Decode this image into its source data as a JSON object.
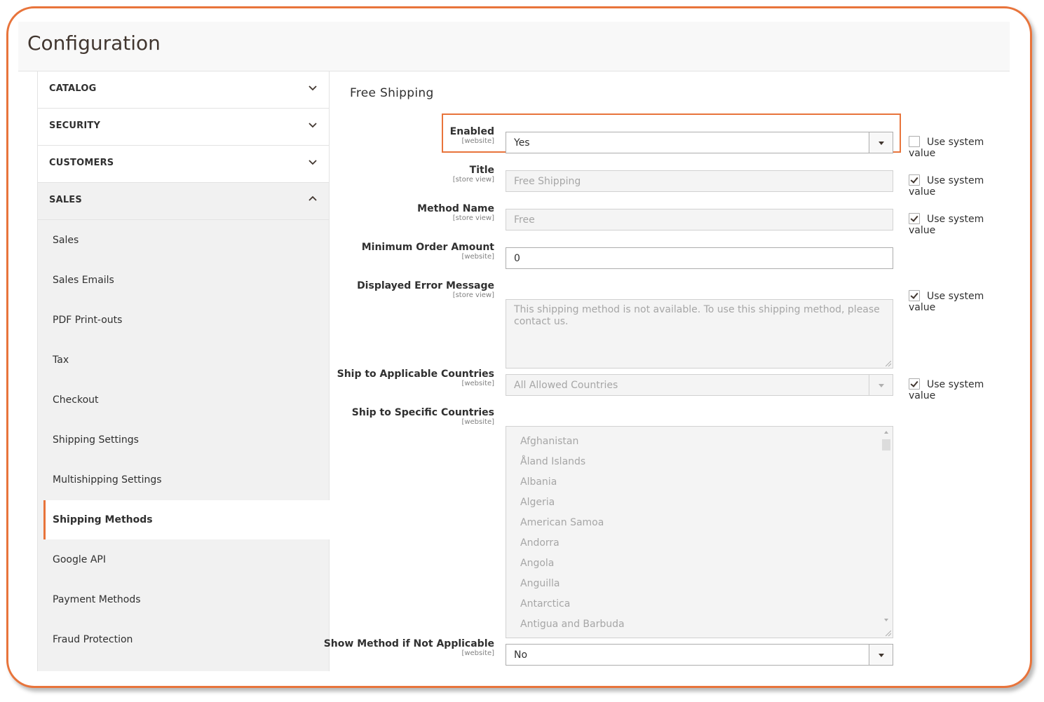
{
  "header": {
    "title": "Configuration"
  },
  "sidebar": {
    "sections": [
      {
        "label": "CATALOG",
        "expanded": false
      },
      {
        "label": "SECURITY",
        "expanded": false
      },
      {
        "label": "CUSTOMERS",
        "expanded": false
      },
      {
        "label": "SALES",
        "expanded": true
      }
    ],
    "items": [
      {
        "label": "Sales"
      },
      {
        "label": "Sales Emails"
      },
      {
        "label": "PDF Print-outs"
      },
      {
        "label": "Tax"
      },
      {
        "label": "Checkout"
      },
      {
        "label": "Shipping Settings"
      },
      {
        "label": "Multishipping Settings"
      },
      {
        "label": "Shipping Methods",
        "active": true
      },
      {
        "label": "Google API"
      },
      {
        "label": "Payment Methods"
      },
      {
        "label": "Fraud Protection"
      }
    ]
  },
  "main": {
    "section_title": "Free Shipping",
    "use_system_value_label": "Use system value",
    "fields": {
      "enabled": {
        "label": "Enabled",
        "scope": "[website]",
        "value": "Yes",
        "use_system": false
      },
      "title": {
        "label": "Title",
        "scope": "[store view]",
        "value": "Free Shipping",
        "use_system": true
      },
      "method_name": {
        "label": "Method Name",
        "scope": "[store view]",
        "value": "Free",
        "use_system": true
      },
      "min_order": {
        "label": "Minimum Order Amount",
        "scope": "[website]",
        "value": "0"
      },
      "error_message": {
        "label": "Displayed Error Message",
        "scope": "[store view]",
        "value": "This shipping method is not available. To use this shipping method, please contact us.",
        "use_system": true
      },
      "applicable_countries": {
        "label": "Ship to Applicable Countries",
        "scope": "[website]",
        "value": "All Allowed Countries",
        "use_system": true
      },
      "specific_countries": {
        "label": "Ship to Specific Countries",
        "scope": "[website]",
        "options": [
          "Afghanistan",
          "Åland Islands",
          "Albania",
          "Algeria",
          "American Samoa",
          "Andorra",
          "Angola",
          "Anguilla",
          "Antarctica",
          "Antigua and Barbuda"
        ]
      },
      "show_method": {
        "label": "Show Method if Not Applicable",
        "scope": "[website]",
        "value": "No"
      }
    }
  },
  "colors": {
    "accent": "#e8743b",
    "sidebar_bg": "#f1f1f1",
    "disabled_bg": "#f4f4f4"
  },
  "icons": {
    "chevron_down": "chevron-down-icon",
    "chevron_up": "chevron-up-icon",
    "select_arrow": "select-arrow-icon"
  }
}
